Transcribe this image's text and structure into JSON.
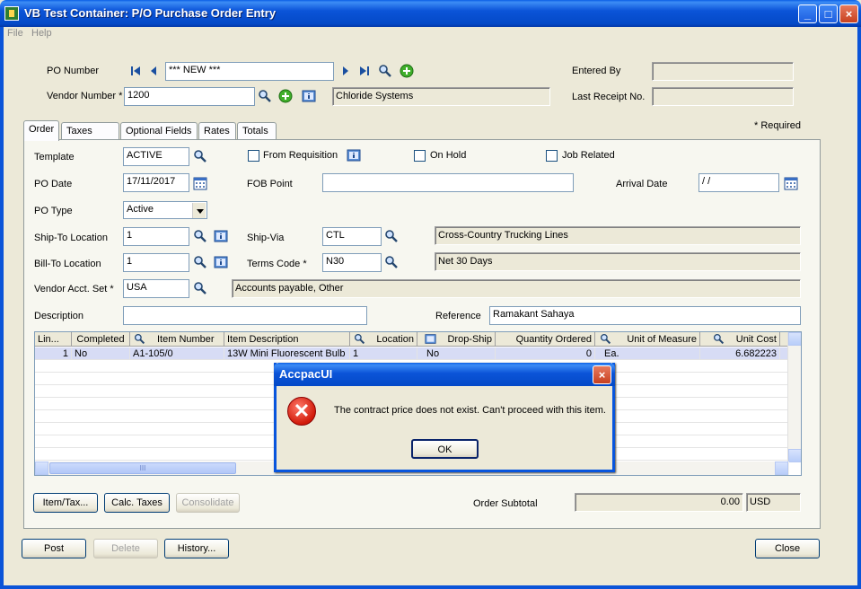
{
  "window": {
    "title": "VB Test Container: P/O Purchase Order Entry"
  },
  "menu": {
    "file": "File",
    "help": "Help"
  },
  "header": {
    "po_number_label": "PO Number",
    "po_number_value": "*** NEW ***",
    "vendor_number_label": "Vendor Number *",
    "vendor_number_value": "1200",
    "vendor_name": "Chloride Systems",
    "entered_by_label": "Entered By",
    "entered_by_value": "",
    "last_receipt_label": "Last Receipt No.",
    "last_receipt_value": "",
    "required_note": "*  Required"
  },
  "tabs": [
    "Order",
    "Taxes",
    "Optional Fields",
    "Rates",
    "Totals"
  ],
  "order": {
    "template_label": "Template",
    "template_value": "ACTIVE",
    "from_requisition_label": "From Requisition",
    "on_hold_label": "On Hold",
    "job_related_label": "Job Related",
    "po_date_label": "PO Date",
    "po_date_value": "17/11/2017",
    "fob_point_label": "FOB Point",
    "fob_point_value": "",
    "arrival_date_label": "Arrival Date",
    "arrival_date_value": " / /",
    "po_type_label": "PO Type",
    "po_type_value": "Active",
    "ship_to_label": "Ship-To Location",
    "ship_to_value": "1",
    "ship_via_label": "Ship-Via",
    "ship_via_value": "CTL",
    "ship_via_desc": "Cross-Country Trucking Lines",
    "bill_to_label": "Bill-To Location",
    "bill_to_value": "1",
    "terms_code_label": "Terms Code *",
    "terms_code_value": "N30",
    "terms_desc": "Net 30 Days",
    "vendor_acct_set_label": "Vendor Acct. Set *",
    "vendor_acct_set_value": "USA",
    "vendor_acct_set_desc": "Accounts payable, Other",
    "description_label": "Description",
    "description_value": "",
    "reference_label": "Reference",
    "reference_value": "Ramakant Sahaya"
  },
  "grid": {
    "columns": [
      "Lin...",
      "Completed",
      "Item Number",
      "Item Description",
      "Location",
      "Drop-Ship",
      "Quantity Ordered",
      "Unit of Measure",
      "Unit Cost"
    ],
    "rows": [
      [
        "1",
        "No",
        "A1-105/0",
        "13W Mini Fluorescent Bulb",
        "1",
        "No",
        "0",
        "Ea.",
        "6.682223"
      ]
    ],
    "hscroll_grip": "III"
  },
  "buttons": {
    "item_tax": "Item/Tax...",
    "calc_taxes": "Calc. Taxes",
    "consolidate": "Consolidate",
    "post": "Post",
    "delete": "Delete",
    "history": "History...",
    "close": "Close"
  },
  "totals": {
    "order_subtotal_label": "Order Subtotal",
    "order_subtotal_value": "0.00",
    "currency": "USD"
  },
  "dialog": {
    "title": "AccpacUI",
    "message": "The contract price does not exist. Can't proceed with this item.",
    "ok": "OK"
  }
}
